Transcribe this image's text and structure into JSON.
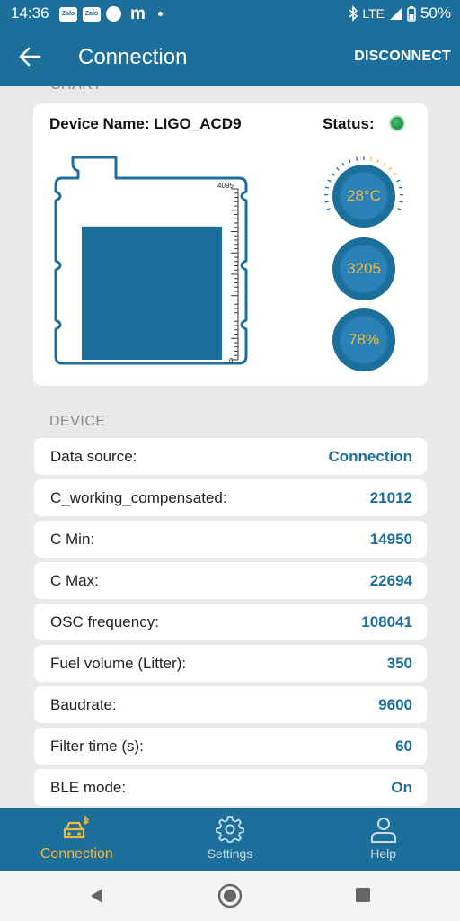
{
  "status_bar": {
    "time": "14:36",
    "notifications": [
      "Zalo",
      "Zalo"
    ],
    "m_icon": "m",
    "network": "LTE",
    "battery": "50%"
  },
  "app_bar": {
    "title": "Connection",
    "action": "DISCONNECT"
  },
  "chart_section": {
    "label": "CHART",
    "device_name": "Device Name: LIGO_ACD9",
    "status_label": "Status:",
    "status_color": "#1f9a4a",
    "tank_scale_max": "4095",
    "tank_scale_min": "0",
    "tank_level_fraction": 0.78,
    "temperature": "28°C",
    "count": "3205",
    "percent": "78%"
  },
  "device_section": {
    "label": "DEVICE",
    "rows": [
      {
        "key": "Data source:",
        "value": "Connection"
      },
      {
        "key": "C_working_compensated:",
        "value": "21012"
      },
      {
        "key": "C Min:",
        "value": "14950"
      },
      {
        "key": "C Max:",
        "value": "22694"
      },
      {
        "key": "OSC frequency:",
        "value": "108041"
      },
      {
        "key": "Fuel volume (Litter):",
        "value": "350"
      },
      {
        "key": "Baudrate:",
        "value": "9600"
      },
      {
        "key": "Filter time (s):",
        "value": "60"
      },
      {
        "key": "BLE mode:",
        "value": "On"
      }
    ]
  },
  "bottom_nav": {
    "tabs": [
      {
        "label": "Connection",
        "icon": "car-bluetooth-icon",
        "active": true
      },
      {
        "label": "Settings",
        "icon": "gear-icon",
        "active": false
      },
      {
        "label": "Help",
        "icon": "person-icon",
        "active": false
      }
    ]
  },
  "colors": {
    "primary": "#1b6f9a",
    "accent": "#f4b93a",
    "background": "#e9e9e9"
  }
}
